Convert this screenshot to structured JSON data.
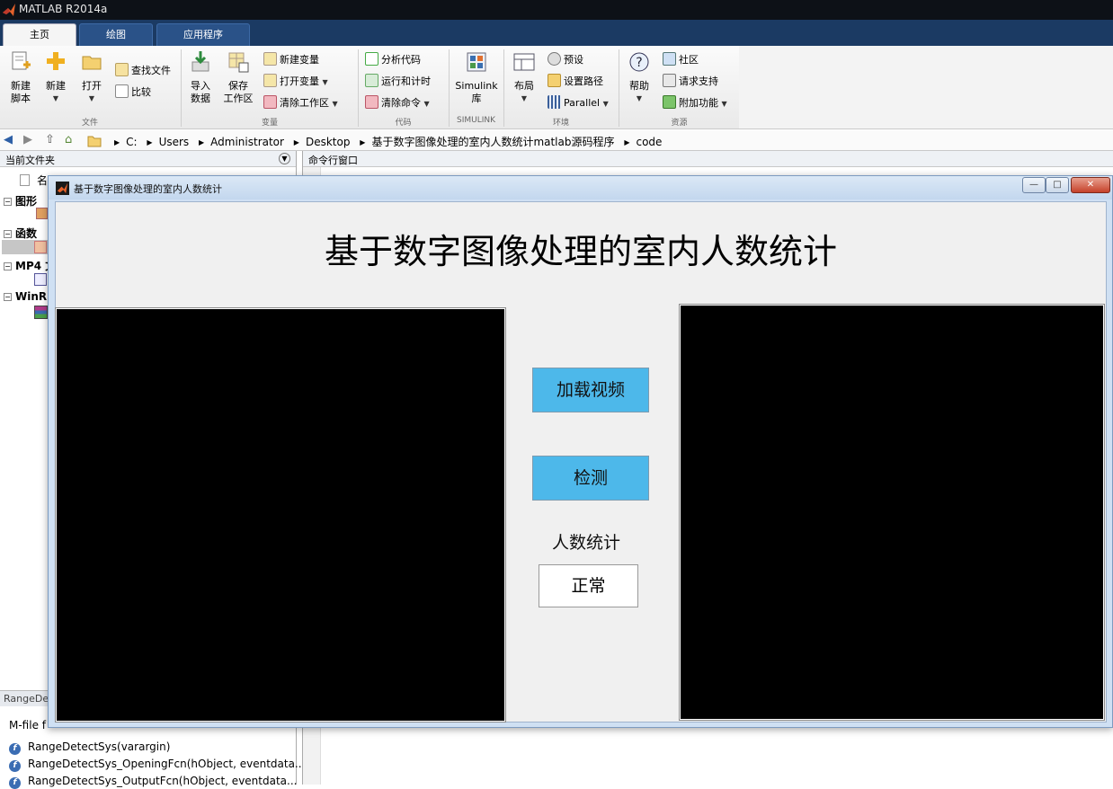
{
  "window_title": "MATLAB R2014a",
  "ribbon": {
    "tabs": [
      {
        "label": "主页",
        "active": true
      },
      {
        "label": "绘图",
        "active": false
      },
      {
        "label": "应用程序",
        "active": false
      }
    ],
    "file": {
      "new_script": [
        "新建",
        "脚本"
      ],
      "new": "新建",
      "open": "打开",
      "find_files": "查找文件",
      "compare": "比较",
      "group": "文件"
    },
    "variable": {
      "import": [
        "导入",
        "数据"
      ],
      "save": [
        "保存",
        "工作区"
      ],
      "new_variable": "新建变量",
      "open_variable": "打开变量",
      "clear_workspace": "清除工作区",
      "group": "变量"
    },
    "code": {
      "analyze": "分析代码",
      "run_time": "运行和计时",
      "clear_commands": "清除命令",
      "group": "代码"
    },
    "simulink": {
      "label": [
        "Simulink",
        "库"
      ],
      "group": "SIMULINK"
    },
    "environment": {
      "layout": "布局",
      "preferences": "预设",
      "set_path": "设置路径",
      "parallel": "Parallel",
      "group": "环境"
    },
    "resources": {
      "help": "帮助",
      "community": "社区",
      "request_support": "请求支持",
      "addons": "附加功能",
      "group": "资源"
    }
  },
  "address": {
    "segments": [
      "C:",
      "Users",
      "Administrator",
      "Desktop",
      "基于数字图像处理的室内人数统计matlab源码程序",
      "code"
    ]
  },
  "current_folder": {
    "title": "当前文件夹",
    "name_col": "名",
    "groups": [
      "图形",
      "函数",
      "MP4 文",
      "WinR"
    ],
    "detail_header": "RangeDe",
    "detail_text": "M-file f",
    "functions": [
      "RangeDetectSys(varargin)",
      "RangeDetectSys_OpeningFcn(hObject, eventdata...",
      "RangeDetectSys_OutputFcn(hObject, eventdata..."
    ]
  },
  "command_window": {
    "title": "命令行窗口"
  },
  "figure": {
    "title": "基于数字图像处理的室内人数统计",
    "heading": "基于数字图像处理的室内人数统计",
    "load_button": "加载视频",
    "detect_button": "检测",
    "count_label": "人数统计",
    "count_value": "正常",
    "win_minimize": "—",
    "win_maximize": "□",
    "win_close": "✕"
  },
  "colors": {
    "button_fill": "#4db8ea",
    "axes_fill": "#000000",
    "title_bar": "#0d1117",
    "tab_strip": "#1b3a63"
  }
}
